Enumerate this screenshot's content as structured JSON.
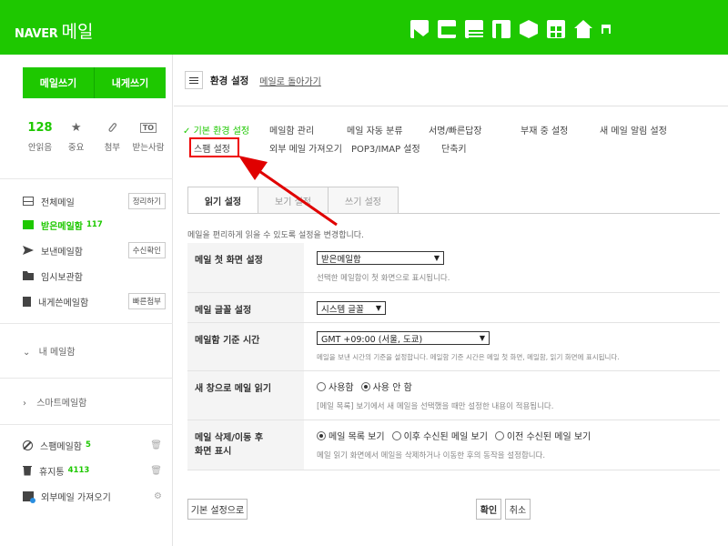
{
  "header": {
    "logo_naver": "NAVER",
    "logo_mail": "메일",
    "icons": [
      "mailbox-icon",
      "calendar-icon",
      "list-icon",
      "note-icon",
      "hexagon-icon",
      "contacts-icon",
      "home-icon",
      "square-icon"
    ]
  },
  "sidebar": {
    "write_label": "메일쓰기",
    "write_self_label": "내게쓰기",
    "quick": [
      {
        "value": "128",
        "label": "안읽음"
      },
      {
        "icon": "★",
        "label": "중요"
      },
      {
        "icon": "attachment-icon",
        "label": "첨부"
      },
      {
        "badge": "TO",
        "label": "받는사람"
      }
    ],
    "boxes": {
      "all": {
        "label": "전체메일",
        "action": "정리하기"
      },
      "inbox": {
        "label": "받은메일함",
        "count": "117"
      },
      "sent": {
        "label": "보낸메일함",
        "action": "수신확인"
      },
      "drafts": {
        "label": "임시보관함"
      },
      "self": {
        "label": "내게쓴메일함",
        "action": "빠른첨부"
      }
    },
    "my_mailbox": "내 메일함",
    "smart_mailbox": "스마트메일함",
    "spam": {
      "label": "스팸메일함",
      "count": "5"
    },
    "trash": {
      "label": "휴지통",
      "count": "4113"
    },
    "external": {
      "label": "외부메일 가져오기"
    }
  },
  "main": {
    "title": "환경 설정",
    "back_link": "메일로 돌아가기",
    "settings_menu": {
      "basic": "기본 환경 설정",
      "mailbox_manage": "메일함 관리",
      "auto_sort": "메일 자동 분류",
      "signature": "서명/빠른답장",
      "absence": "부재 중 설정",
      "new_mail_alert": "새 메일 알림 설정",
      "spam": "스팸 설정",
      "external_fetch": "외부 메일 가져오기",
      "pop_imap": "POP3/IMAP 설정",
      "shortcut": "단축키"
    },
    "tabs": [
      "읽기 설정",
      "보기 설정",
      "쓰기 설정"
    ],
    "description": "메일을 편리하게 읽을 수 있도록 설정을 변경합니다.",
    "rows": {
      "first_screen": {
        "label": "메일 첫 화면 설정",
        "value": "받은메일함",
        "hint": "선택한 메일함이 첫 화면으로 표시됩니다."
      },
      "font": {
        "label": "메일 글꼴 설정",
        "value": "시스템 글꼴"
      },
      "timezone": {
        "label": "메일함 기준 시간",
        "value": "GMT +09:00 (서울, 도쿄)",
        "hint": "메일을 보낸 시간의 기준을 설정합니다. 메일함 기준 시간은 메일 첫 화면, 메일함, 읽기 화면에 표시됩니다."
      },
      "new_window": {
        "label": "새 창으로 메일 읽기",
        "options": [
          "사용함",
          "사용 안 함"
        ],
        "selected": 1,
        "hint": "[메일 목록] 보기에서 새 메일을 선택했을 때만 설정한 내용이 적용됩니다."
      },
      "after_delete": {
        "label_line1": "메일 삭제/이동 후",
        "label_line2": "화면 표시",
        "options": [
          "메일 목록 보기",
          "이후 수신된 메일 보기",
          "이전 수신된 메일 보기"
        ],
        "selected": 0,
        "hint": "메일 읽기 화면에서 메일을 삭제하거나 이동한 후의 동작을 설정합니다."
      }
    },
    "buttons": {
      "reset": "기본 설정으로",
      "confirm": "확인",
      "cancel": "취소"
    }
  },
  "colors": {
    "brand_green": "#1ec800",
    "annotation_red": "#e00000"
  }
}
